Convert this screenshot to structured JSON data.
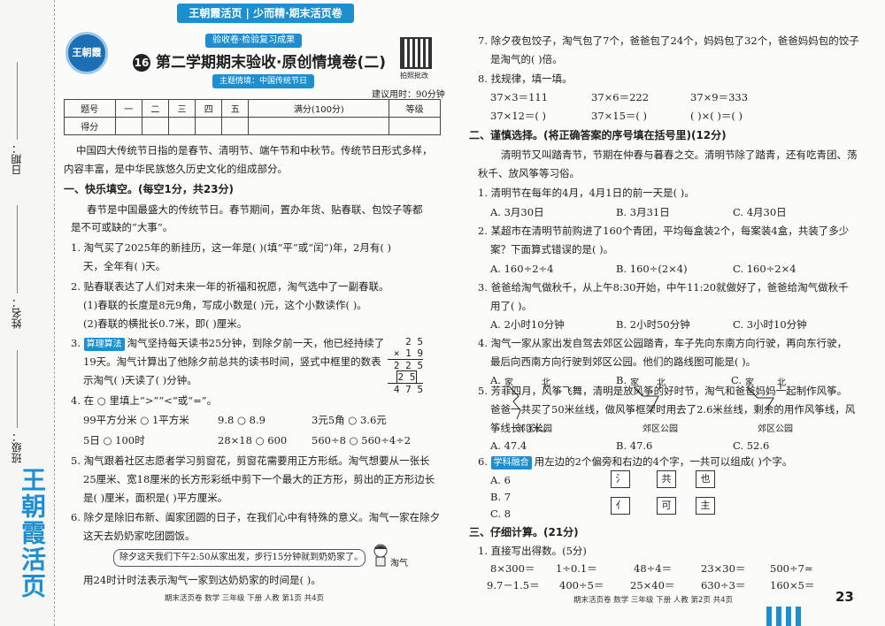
{
  "header": {
    "brand": "王朝霞活页",
    "series": "少而精·期末活页卷",
    "sub_tag": "验收卷·检验复习成果",
    "theme_tag": "主题情境：中国传统节日",
    "title_num": "16",
    "title": "第二学期期末验收·原创情境卷(二)",
    "qr_label": "拍照批改",
    "time": "建议用时：90分钟",
    "logo_text": "王朝霞"
  },
  "binding": {
    "date": "日期：",
    "name": "姓名：",
    "class": "班级：",
    "brand": "王朝霞活页"
  },
  "score_table": {
    "row1": [
      "题号",
      "一",
      "二",
      "三",
      "四",
      "五",
      "满分(100分)",
      "等级"
    ],
    "row2": [
      "得分",
      "",
      "",
      "",
      "",
      "",
      "",
      ""
    ]
  },
  "left": {
    "intro1": "中国四大传统节日指的是春节、清明节、端午节和中秋节。传统节日形式多样，",
    "intro2": "内容丰富，是中华民族悠久历史文化的组成部分。",
    "sec1": "一、快乐填空。(每空1分，共23分)",
    "p1": "春节是中国最盛大的传统节日。春节期间，置办年货、贴春联、包饺子等都",
    "p2": "是不可或缺的“大事”。",
    "q1a": "1. 淘气买了2025年的新挂历，这一年是(          )(填“平”或“闰”)年，2月有(          )",
    "q1b": "天，全年有(          )天。",
    "q2a": "2. 贴春联表达了人们对未来一年的祈福和祝愿，淘气选中了一副春联。",
    "q2b": "(1)春联的长度是8元9角，写成小数是(          )元，这个小数读作(                    )。",
    "q2c": "(2)春联的横批长0.7米，即(          )厘米。",
    "q3tag": "算理算法",
    "q3a": "淘气坚持每天读书25分钟，到除夕前一天，他已经持续了",
    "q3b": "19天。淘气计算出了他除夕前总共的读书时间，竖式中框里的数表",
    "q3c": "示淘气(          )天读了(          )分钟。",
    "vert": [
      "2 5",
      "× 1 9",
      "2 2 5",
      "2 5",
      "4 7 5"
    ],
    "q4": "4. 在 ○ 里填上“>”“<”或“=”。",
    "q4r1": [
      "99平方分米 ○ 1平方米",
      "9.8 ○ 8.9",
      "3元5角 ○ 3.6元"
    ],
    "q4r2": [
      "5日 ○ 100时",
      "28×18 ○ 600",
      "560÷8 ○ 560÷4÷2"
    ],
    "q5a": "5. 淘气跟着社区志愿者学习剪窗花，剪窗花需要用正方形纸。淘气想要从一张长",
    "q5b": "25厘米、宽18厘米的长方形彩纸中剪下一个最大的正方形，剪出的正方形边长",
    "q5c": "是(          )厘米，面积是(          )平方厘米。",
    "q6a": "6. 除夕是除旧布新、阖家团圆的日子，在我们心中有特殊的意义。淘气一家在除夕",
    "q6b": "这天去奶奶家吃团圆饭。",
    "bubble": "除夕这天我们下午2:50从家出发，步行15分钟就到奶奶家了。",
    "kid": "淘气",
    "q6c": "用24时计时法表示淘气一家到达奶奶家的时间是(          )。",
    "footer": "期末活页卷   数学   三年级   下册   人教   第1页   共4页"
  },
  "right": {
    "q7a": "7. 除夕夜包饺子，淘气包了7个，爸爸包了24个，妈妈包了32个，爸爸妈妈包的饺子",
    "q7b": "是淘气的(          )倍。",
    "q8": "8. 找规律，填一填。",
    "q8r1": [
      "37×3＝111",
      "37×6＝222",
      "37×9＝333"
    ],
    "q8r2": [
      "37×12＝(          )",
      "37×15＝(          )",
      "(     )×(     )＝(          )"
    ],
    "sec2": "二、谨慎选择。(将正确答案的序号填在括号里)(12分)",
    "p1": "清明节又叫踏青节，节期在仲春与暮春之交。清明节除了踏青，还有吃青团、荡",
    "p2": "秋千、放风筝等习俗。",
    "c1": "1. 清明节在每年的4月，4月1日的前一天是(          )。",
    "c1o": [
      "A. 3月30日",
      "B. 3月31日",
      "C. 4月30日"
    ],
    "c2a": "2. 某超市在清明节前购进了160个青团，平均每盒装2个，每案装4盒，共装了多少",
    "c2b": "案？下面算式错误的是(          )。",
    "c2o": [
      "A. 160÷2÷4",
      "B. 160÷(2×4)",
      "C. 160÷2×4"
    ],
    "c3a": "3. 爸爸给淘气做秋千，从上午8:30开始，中午11:20就做好了，爸爸给淘气做秋千",
    "c3b": "用了(          )。",
    "c3o": [
      "A. 2小时10分钟",
      "B. 2小时50分钟",
      "C. 3小时10分钟"
    ],
    "c4a": "4. 淘气一家从家出发自驾去郊区公园踏青，车子先向东南方向行驶，再向东行驶，",
    "c4b": "最后向西南方向行驶到郊区公园。他们的路线图可能是(          )。",
    "c4opt": [
      "A.",
      "B.",
      "C."
    ],
    "home": "家",
    "north": "北",
    "park": "郊区公园",
    "c5a": "5. 芳菲四月，风筝飞舞，清明是放风筝的好时节，淘气和爸爸妈妈一起制作风筝。",
    "c5b": "爸爸一共买了50米丝线，做风筝框架时用去了2.6米丝线，剩余的用作风筝线，风",
    "c5c": "筝线长(          )米。",
    "c5o": [
      "A. 47.4",
      "B. 47.6",
      "C. 52.6"
    ],
    "c6tag": "学科融合",
    "c6": "用左边的2个偏旁和右边的4个字，一共可以组成(          )个字。",
    "c6o": [
      "A. 6",
      "B. 7",
      "C. 8"
    ],
    "c6left": [
      "氵",
      "亻"
    ],
    "c6right": [
      "共",
      "也",
      "可",
      "主"
    ],
    "sec3": "三、仔细计算。(21分)",
    "d1": "1. 直接写出得数。(5分)",
    "d1r1": [
      "8×300＝",
      "1÷0.1＝",
      "48÷4＝",
      "23×30＝",
      "500÷7≈"
    ],
    "d1r2": [
      "9.7－1.5＝",
      "400÷5＝",
      "25×40＝",
      "630÷3＝",
      "160×5＝"
    ],
    "footer": "期末活页卷   数学   三年级   下册   人教   第2页   共4页",
    "page": "23"
  }
}
